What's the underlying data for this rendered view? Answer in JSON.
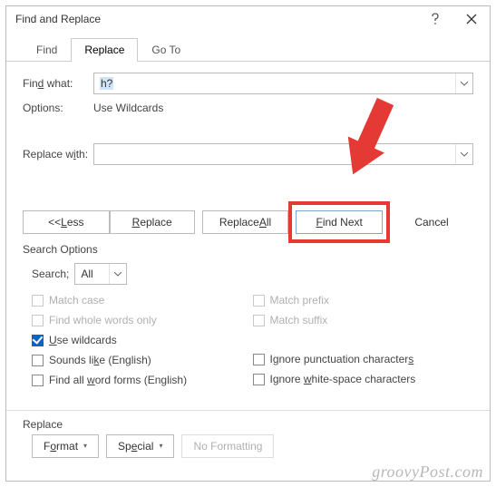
{
  "title": "Find and Replace",
  "tabs": {
    "find": "Find",
    "replace": "Replace",
    "goto": "Go To"
  },
  "find": {
    "label": "Find what:",
    "value": "h?",
    "options_label": "Options:",
    "options_value": "Use Wildcards"
  },
  "replace": {
    "label": "Replace with:",
    "value": ""
  },
  "buttons": {
    "less": "<< Less",
    "replace": "Replace",
    "replace_all": "Replace All",
    "find_next": "Find Next",
    "cancel": "Cancel"
  },
  "search_options": {
    "header": "Search Options",
    "search_label": "Search;",
    "search_value": "All",
    "match_case": "Match case",
    "whole_words": "Find whole words only",
    "use_wildcards": "Use wildcards",
    "sounds_like": "Sounds like (English)",
    "word_forms": "Find all word forms (English)",
    "match_prefix": "Match prefix",
    "match_suffix": "Match suffix",
    "ignore_punct": "Ignore punctuation characters",
    "ignore_white": "Ignore white-space characters"
  },
  "bottom": {
    "header": "Replace",
    "format": "Format",
    "special": "Special",
    "no_formatting": "No Formatting"
  },
  "watermark": "groovyPost.com"
}
